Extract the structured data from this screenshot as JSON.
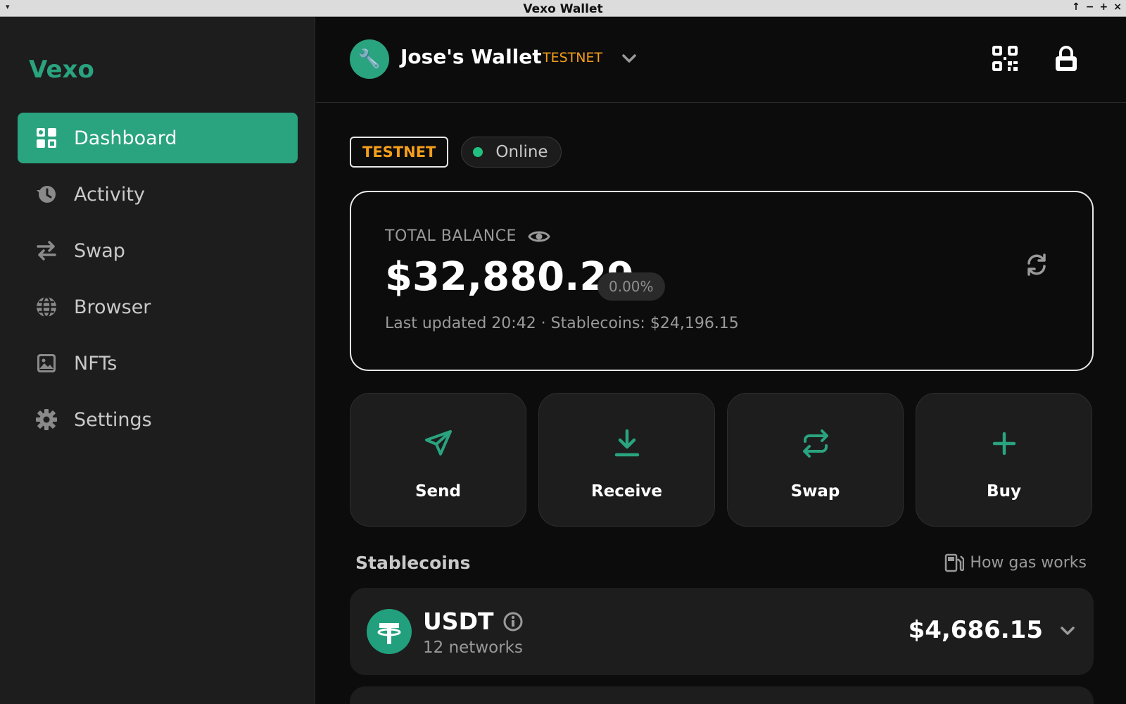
{
  "window": {
    "title": "Vexo Wallet"
  },
  "sidebar": {
    "brand": "Vexo",
    "items": [
      {
        "label": "Dashboard",
        "icon": "dashboard-icon",
        "active": true
      },
      {
        "label": "Activity",
        "icon": "history-icon",
        "active": false
      },
      {
        "label": "Swap",
        "icon": "swap-arrows-icon",
        "active": false
      },
      {
        "label": "Browser",
        "icon": "globe-icon",
        "active": false
      },
      {
        "label": "NFTs",
        "icon": "image-icon",
        "active": false
      },
      {
        "label": "Settings",
        "icon": "gear-icon",
        "active": false
      }
    ]
  },
  "header": {
    "wallet_name": "Jose's Wallet",
    "network": "TESTNET",
    "avatar_icon": "wrench-icon"
  },
  "status": {
    "network_badge": "TESTNET",
    "connection": "Online"
  },
  "balance": {
    "label": "TOTAL BALANCE",
    "amount": "$32,880.29",
    "change": "0.00%",
    "updated": "Last updated 20:42 · Stablecoins: $24,196.15"
  },
  "actions": [
    {
      "label": "Send",
      "icon": "send-icon"
    },
    {
      "label": "Receive",
      "icon": "download-icon"
    },
    {
      "label": "Swap",
      "icon": "swap-icon"
    },
    {
      "label": "Buy",
      "icon": "plus-icon"
    }
  ],
  "stablecoins": {
    "title": "Stablecoins",
    "gas_link": "How gas works",
    "tokens": [
      {
        "symbol": "USDT",
        "networks": "12 networks",
        "value": "$4,686.15"
      }
    ]
  },
  "colors": {
    "accent": "#2aa37f",
    "warning": "#f59e1b",
    "online": "#22c080",
    "background": "#0c0c0c",
    "panel": "#1d1d1d"
  }
}
